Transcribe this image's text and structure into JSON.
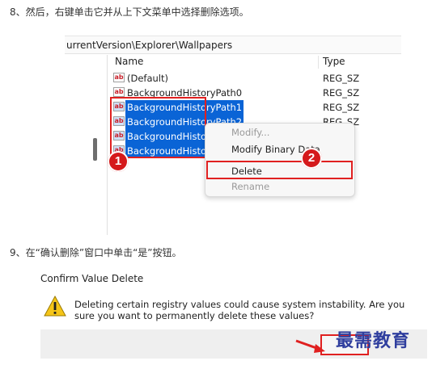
{
  "steps": {
    "step8": "8、然后，右键单击它并从上下文菜单中选择删除选项。",
    "step9": "9、在“确认删除”窗口中单击“是”按钮。"
  },
  "registry": {
    "path": "urrentVersion\\Explorer\\Wallpapers",
    "columns": {
      "name": "Name",
      "type": "Type"
    },
    "rows": [
      {
        "name": "(Default)",
        "type": "REG_SZ",
        "selected": false
      },
      {
        "name": "BackgroundHistoryPath0",
        "type": "REG_SZ",
        "selected": false
      },
      {
        "name": "BackgroundHistoryPath1",
        "type": "REG_SZ",
        "selected": true
      },
      {
        "name": "BackgroundHistoryPath2",
        "type": "REG_SZ",
        "selected": true
      },
      {
        "name": "BackgroundHistory",
        "type": "",
        "selected": true
      },
      {
        "name": "BackgroundHistory",
        "type": "",
        "selected": true
      }
    ],
    "icon": "ab",
    "context_menu": {
      "items": [
        {
          "label": "Modify...",
          "disabled": true
        },
        {
          "label": "Modify Binary Data",
          "disabled": false
        },
        {
          "label": "Delete",
          "disabled": false
        },
        {
          "label": "Rename",
          "disabled": true
        }
      ]
    },
    "badges": {
      "one": "1",
      "two": "2"
    }
  },
  "dialog": {
    "title": "Confirm Value Delete",
    "message": "Deleting certain registry values could cause system instability. Are you sure you want to permanently delete these values?"
  },
  "watermark": "最需教育",
  "colors": {
    "selection": "#0a64d6",
    "highlight_red": "#e02020",
    "badge_red": "#d5191b"
  }
}
